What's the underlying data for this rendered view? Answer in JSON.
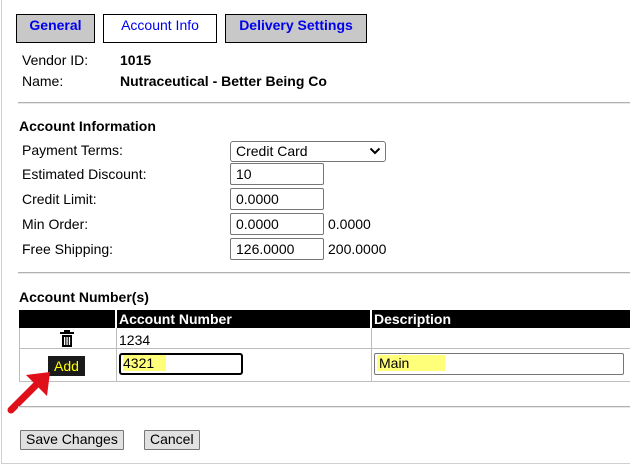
{
  "tabs": [
    {
      "label": "General"
    },
    {
      "label": "Account Info"
    },
    {
      "label": "Delivery Settings"
    }
  ],
  "vendor": {
    "id_label": "Vendor ID:",
    "id_value": "1015",
    "name_label": "Name:",
    "name_value": "Nutraceutical - Better Being Co"
  },
  "account_info": {
    "heading": "Account Information",
    "payment_terms_label": "Payment Terms:",
    "payment_terms_value": "Credit Card",
    "estimated_discount_label": "Estimated Discount:",
    "estimated_discount_value": "10",
    "credit_limit_label": "Credit Limit:",
    "credit_limit_value": "0.0000",
    "min_order_label": "Min Order:",
    "min_order_value": "0.0000",
    "min_order_secondary": "0.0000",
    "free_shipping_label": "Free Shipping:",
    "free_shipping_value": "126.0000",
    "free_shipping_secondary": "200.0000"
  },
  "account_numbers": {
    "heading": "Account Number(s)",
    "columns": [
      "",
      "Account Number",
      "Description"
    ],
    "rows": [
      {
        "account_number": "1234",
        "description": ""
      }
    ],
    "new_row": {
      "add_label": "Add",
      "account_number_value": "4321",
      "description_value": "Main"
    }
  },
  "actions": {
    "save_label": "Save Changes",
    "cancel_label": "Cancel"
  },
  "colors": {
    "tab_link": "#0000ee",
    "highlight": "#ffff00",
    "arrow": "#e0101a",
    "header_bg": "#000000"
  },
  "icons": {
    "delete": "trash-icon",
    "arrow": "red-arrow-pointer",
    "dropdown": "chevron-down-icon"
  }
}
